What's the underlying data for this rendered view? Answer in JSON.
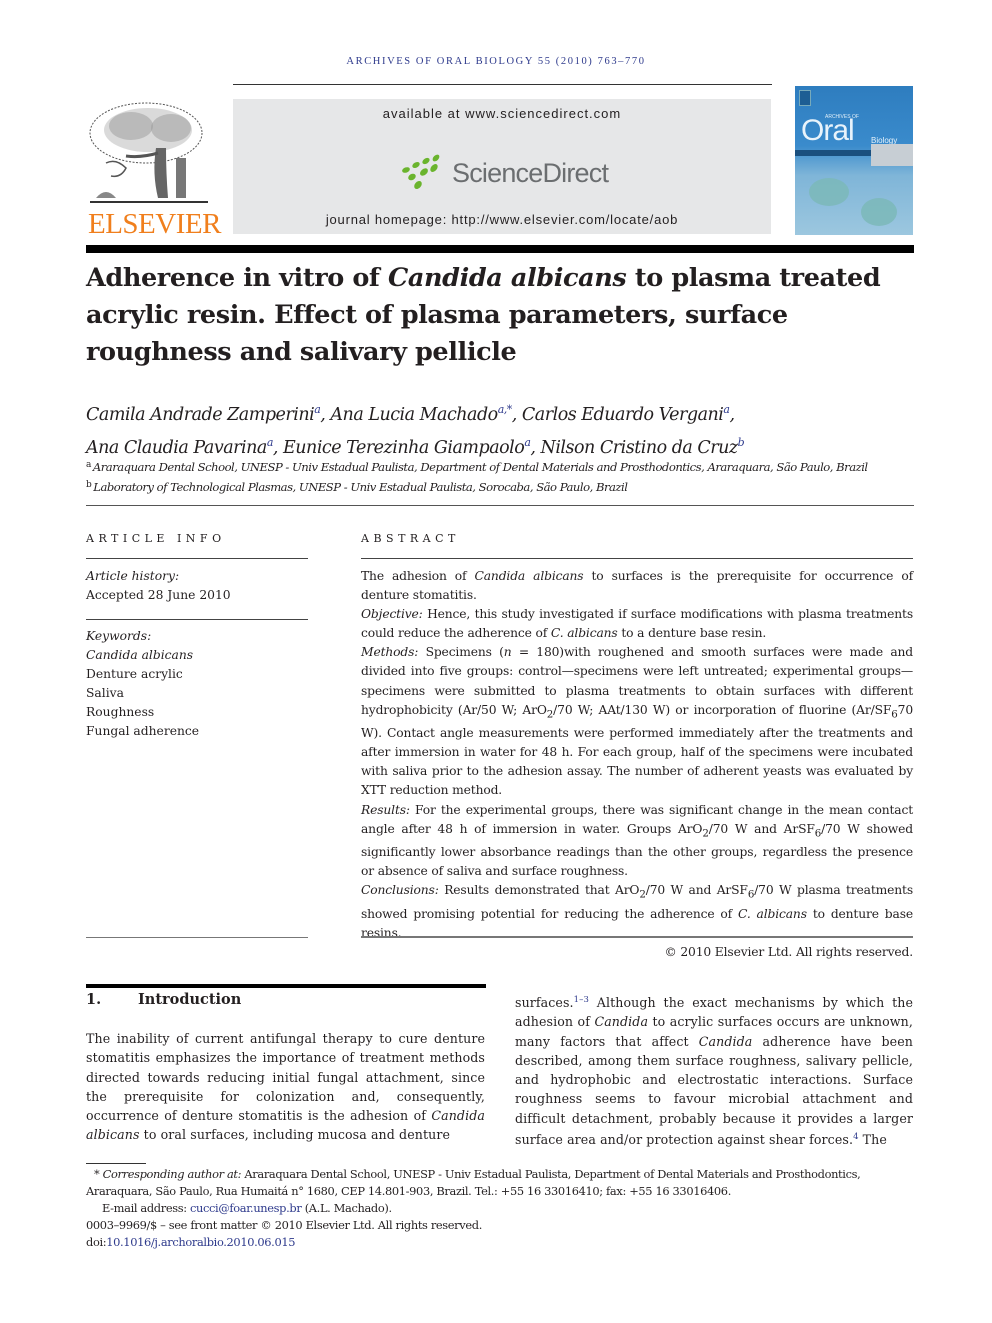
{
  "running_head": "ARCHIVES OF ORAL BIOLOGY 55 (2010) 763–770",
  "masthead": {
    "publisher": "ELSEVIER",
    "available_at": "available at www.sciencedirect.com",
    "sciencedirect_logo": "ScienceDirect",
    "homepage": "journal homepage: http://www.elsevier.com/locate/aob",
    "cover": {
      "small_title": "ARCHIVES OF",
      "big_title": "Oral",
      "subtitle": "Biology"
    },
    "colors": {
      "elsevier_orange": "#f07f1d",
      "sd_green": "#6ab42d",
      "sd_gray": "#6b6e70",
      "link_blue": "#2e3a8c",
      "cover_blue": "#2e7dbf"
    }
  },
  "title": {
    "part1": "Adherence in vitro of ",
    "italic": "Candida albicans",
    "part2": " to plasma treated acrylic resin. Effect of plasma parameters, surface roughness and salivary pellicle"
  },
  "authors": [
    {
      "name": "Camila Andrade Zamperini",
      "aff": "a",
      "sep": ", "
    },
    {
      "name": "Ana Lucia Machado",
      "aff": "a,*",
      "sep": ", "
    },
    {
      "name": "Carlos Eduardo Vergani",
      "aff": "a",
      "sep": ","
    },
    {
      "name": "Ana Claudia Pavarina",
      "aff": "a",
      "sep": ", "
    },
    {
      "name": "Eunice Terezinha Giampaolo",
      "aff": "a",
      "sep": ", "
    },
    {
      "name": "Nilson Cristino da Cruz",
      "aff": "b",
      "sep": ""
    }
  ],
  "affiliations": [
    {
      "mark": "a",
      "text": "Araraquara Dental School, UNESP - Univ Estadual Paulista, Department of Dental Materials and Prosthodontics, Araraquara, São Paulo, Brazil"
    },
    {
      "mark": "b",
      "text": "Laboratory of Technological Plasmas, UNESP - Univ Estadual Paulista, Sorocaba, São Paulo, Brazil"
    }
  ],
  "article_info": {
    "heading": "ARTICLE INFO",
    "history_label": "Article history:",
    "accepted": "Accepted 28 June 2010",
    "keywords_label": "Keywords:",
    "keywords": [
      "Candida albicans",
      "Denture acrylic",
      "Saliva",
      "Roughness",
      "Fungal adherence"
    ]
  },
  "abstract": {
    "heading": "ABSTRACT",
    "intro_a": "The adhesion of ",
    "intro_it": "Candida albicans",
    "intro_b": " to surfaces is the prerequisite for occurrence of denture stomatitis.",
    "objective_label": "Objective:",
    "objective_a": " Hence, this study investigated if surface modifications with plasma treatments could reduce the adherence of ",
    "objective_it": "C. albicans",
    "objective_b": " to a denture base resin.",
    "methods_label": "Methods:",
    "methods_a": " Specimens (",
    "methods_n": "n",
    "methods_b": " = 180)with roughened and smooth surfaces were made and divided into five groups: control—specimens were left untreated; experimental groups—specimens were submitted to plasma treatments to obtain surfaces with different hydrophobicity (Ar/50 W; ArO",
    "methods_sub1": "2",
    "methods_c": "/70 W; AAt/130 W) or incorporation of fluorine (Ar/SF",
    "methods_sub2": "6",
    "methods_d": "70 W). Contact angle measurements were performed immediately after the treatments and after immersion in water for 48 h. For each group, half of the specimens were incubated with saliva prior to the adhesion assay. The number of adherent yeasts was evaluated by XTT reduction method.",
    "results_label": "Results:",
    "results_a": " For the experimental groups, there was significant change in the mean contact angle after 48 h of immersion in water. Groups ArO",
    "results_sub1": "2",
    "results_b": "/70 W and ArSF",
    "results_sub2": "6",
    "results_c": "/70 W showed significantly lower absorbance readings than the other groups, regardless the presence or absence of saliva and surface roughness.",
    "conclusions_label": "Conclusions:",
    "conclusions_a": " Results demonstrated that ArO",
    "conclusions_sub1": "2",
    "conclusions_b": "/70 W and ArSF",
    "conclusions_sub2": "6",
    "conclusions_c": "/70 W plasma treatments showed promising potential for reducing the adherence of ",
    "conclusions_it": "C. albicans",
    "conclusions_d": " to denture base resins.",
    "copyright": "© 2010 Elsevier Ltd. All rights reserved."
  },
  "introduction": {
    "number": "1.",
    "heading": "Introduction",
    "left_a": "The inability of current antifungal therapy to cure denture stomatitis emphasizes the importance of treatment methods directed towards reducing initial fungal attachment, since the prerequisite for colonization and, consequently, occurrence of denture stomatitis is the adhesion of ",
    "left_it": "Candida albicans",
    "left_b": " to oral surfaces, including mucosa and denture",
    "right_a": "surfaces.",
    "right_ref1": "1–3",
    "right_b": " Although the exact mechanisms by which the adhesion of ",
    "right_it1": "Candida",
    "right_c": " to acrylic surfaces occurs are unknown, many factors that affect ",
    "right_it2": "Candida",
    "right_d": " adherence have been described, among them surface roughness, salivary pellicle, and hydrophobic and electrostatic interactions. Surface roughness seems to favour microbial attachment and difficult detachment, probably because it provides a larger surface area and/or protection against shear forces.",
    "right_ref2": "4",
    "right_e": " The"
  },
  "footnotes": {
    "star": "*",
    "corr_label": "Corresponding author at:",
    "corr_text": " Araraquara Dental School, UNESP - Univ Estadual Paulista, Department of Dental Materials and Prosthodontics, Araraquara, São Paulo, Rua Humaitá n° 1680, CEP 14.801-903, Brazil. Tel.: +55 16 33016410; fax: +55 16 33016406.",
    "email_label": "E-mail address: ",
    "email": "cucci@foar.unesp.br",
    "email_suffix": " (A.L. Machado).",
    "issn": "0003–9969/$ – see front matter © 2010 Elsevier Ltd. All rights reserved.",
    "doi_label": "doi:",
    "doi": "10.1016/j.archoralbio.2010.06.015"
  }
}
